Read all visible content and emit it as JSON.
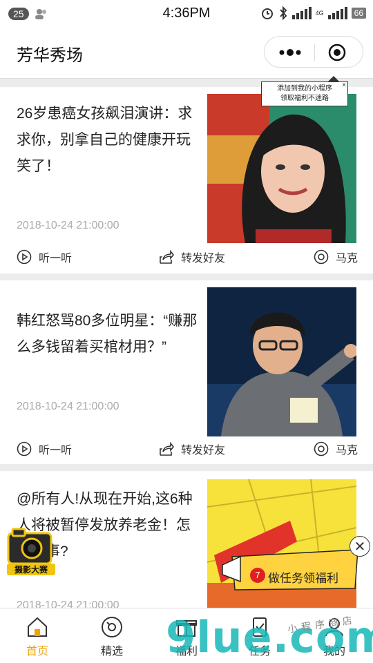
{
  "status_bar": {
    "badge": "25",
    "time": "4:36PM",
    "battery": "66",
    "network": "4G"
  },
  "header": {
    "title": "芳华秀场"
  },
  "tooltip": {
    "line1": "添加到我的小程序",
    "line2": "领取福利不迷路",
    "close": "×"
  },
  "articles": [
    {
      "title": "26岁患癌女孩飙泪演讲：求求你，别拿自己的健康开玩笑了！",
      "date": "2018-10-24 21:00:00",
      "image": "woman-smiling-photo"
    },
    {
      "title": "韩红怒骂80多位明星：“赚那么多钱留着买棺材用？”",
      "date": "2018-10-24 21:00:00",
      "image": "man-pointing-photo"
    },
    {
      "title": "@所有人!从现在开始,这6种人将被暂停发放养老金！怎么回事?",
      "date": "2018-10-24 21:00:00",
      "image": "yellow-poster-photo"
    }
  ],
  "actions": {
    "listen": "听一听",
    "share": "转发好友",
    "mark": "马克"
  },
  "float_camera": {
    "label": "摄影大赛"
  },
  "promo": {
    "count": "7",
    "label": "做任务领福利",
    "close": "✕"
  },
  "tabs": [
    {
      "label": "首页",
      "icon": "home-icon",
      "active": true
    },
    {
      "label": "精选",
      "icon": "disc-icon",
      "active": false
    },
    {
      "label": "福利",
      "icon": "gift-icon",
      "active": false
    },
    {
      "label": "任务",
      "icon": "task-icon",
      "active": false
    },
    {
      "label": "我的",
      "icon": "user-icon",
      "active": false
    }
  ],
  "watermark": {
    "text": "9lue.com",
    "tagline": "小程序商店"
  },
  "colors": {
    "accent": "#f0a400",
    "badge_red": "#e02020",
    "promo_yellow": "#ffd23f",
    "watermark_teal": "#18b8b8"
  }
}
